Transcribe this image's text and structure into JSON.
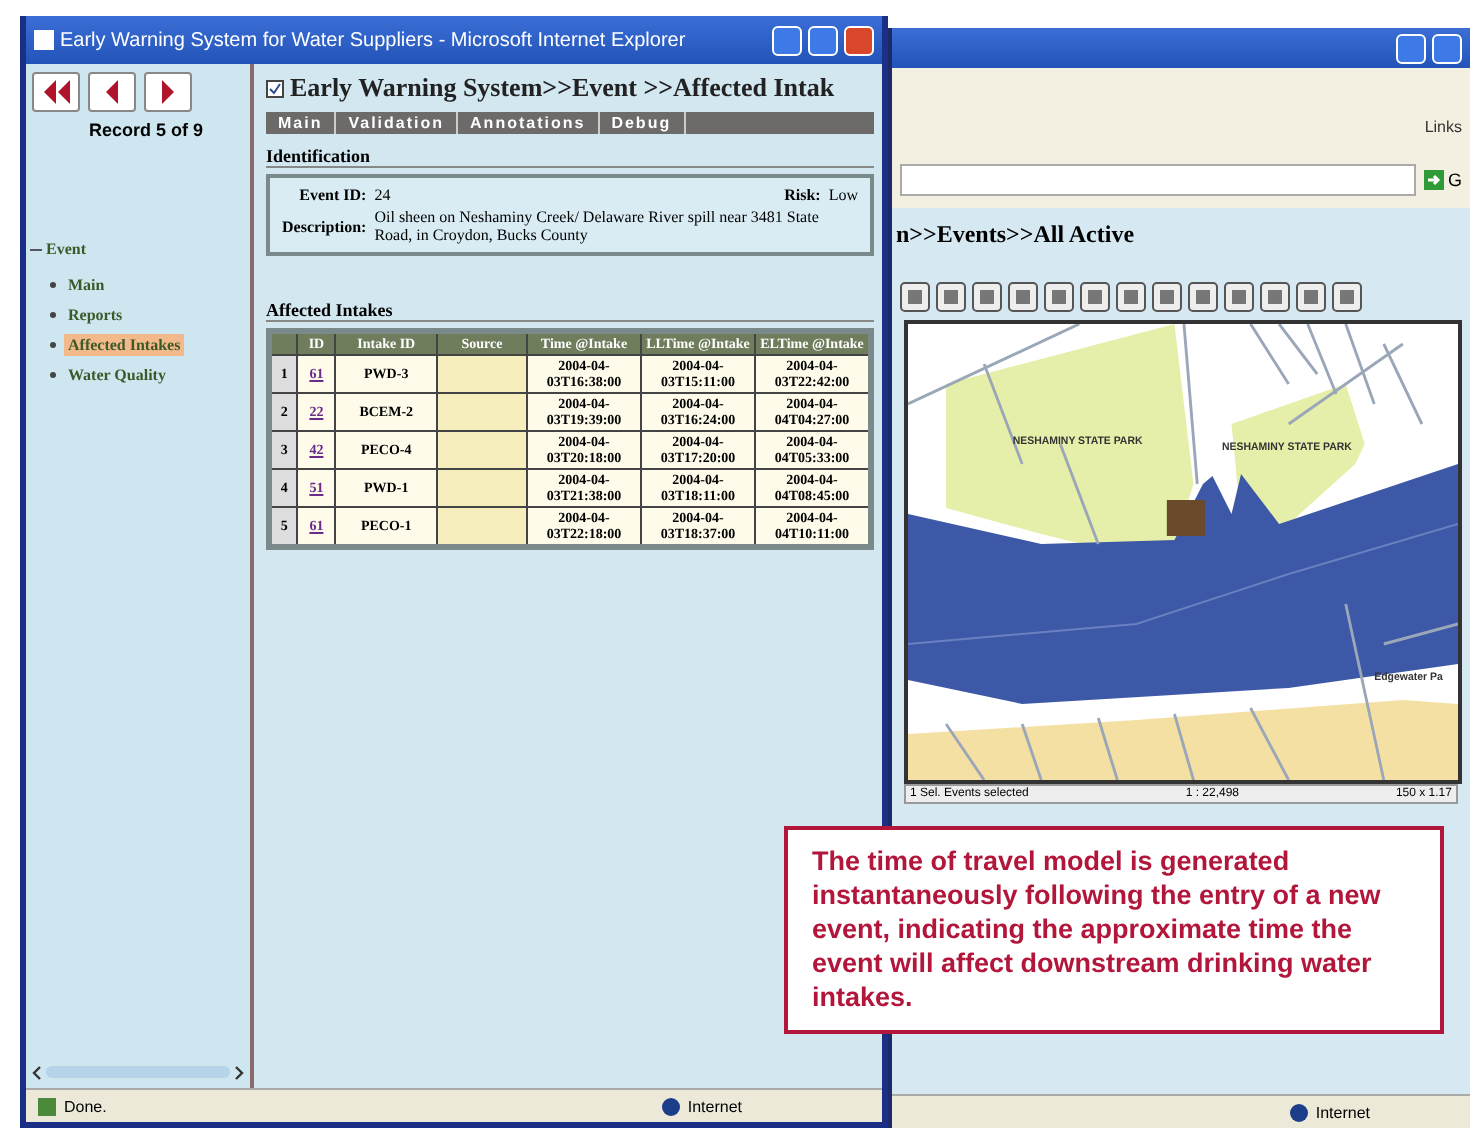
{
  "back_window": {
    "links_label": "Links",
    "go_label": "G",
    "breadcrumb": "n>>Events>>All Active",
    "map_labels": [
      {
        "text": "NESHAMINY STATE PARK"
      },
      {
        "text": "NESHAMINY STATE PARK"
      },
      {
        "text": "Edgewater Pa"
      }
    ],
    "map_status": [
      "1 Sel. Events selected",
      "1 : 22,498",
      "150 x 1.17"
    ],
    "status": "Internet"
  },
  "front_window": {
    "title": "Early Warning System for Water Suppliers - Microsoft Internet Explorer",
    "record": "Record 5 of 9",
    "tree": [
      {
        "label": "Event",
        "expanded": true,
        "children": [
          {
            "label": "Main",
            "selected": false
          },
          {
            "label": "Reports",
            "selected": false
          },
          {
            "label": "Affected Intakes",
            "selected": true
          },
          {
            "label": "Water Quality",
            "selected": false
          }
        ]
      }
    ],
    "breadcrumb": "Early Warning System>>Event >>Affected Intak",
    "tabs": [
      "Main",
      "Validation",
      "Annotations",
      "Debug"
    ],
    "identification": {
      "heading": "Identification",
      "event_id_label": "Event ID:",
      "event_id": "24",
      "risk_label": "Risk:",
      "risk": "Low",
      "description_label": "Description:",
      "description": "Oil sheen on Neshaminy Creek/ Delaware River spill near 3481 State Road, in Croydon, Bucks County"
    },
    "intakes": {
      "heading": "Affected Intakes",
      "columns": [
        "ID",
        "Intake ID",
        "Source",
        "Time @Intake",
        "LLTime @Intake",
        "ELTime @Intake"
      ],
      "rows": [
        {
          "n": "1",
          "id": "61",
          "intake": "PWD-3",
          "source": "",
          "time": "2004-04-03T16:38:00",
          "lltime": "2004-04-03T15:11:00",
          "eltime": "2004-04-03T22:42:00"
        },
        {
          "n": "2",
          "id": "22",
          "intake": "BCEM-2",
          "source": "",
          "time": "2004-04-03T19:39:00",
          "lltime": "2004-04-03T16:24:00",
          "eltime": "2004-04-04T04:27:00"
        },
        {
          "n": "3",
          "id": "42",
          "intake": "PECO-4",
          "source": "",
          "time": "2004-04-03T20:18:00",
          "lltime": "2004-04-03T17:20:00",
          "eltime": "2004-04-04T05:33:00"
        },
        {
          "n": "4",
          "id": "51",
          "intake": "PWD-1",
          "source": "",
          "time": "2004-04-03T21:38:00",
          "lltime": "2004-04-03T18:11:00",
          "eltime": "2004-04-04T08:45:00"
        },
        {
          "n": "5",
          "id": "61",
          "intake": "PECO-1",
          "source": "",
          "time": "2004-04-03T22:18:00",
          "lltime": "2004-04-03T18:37:00",
          "eltime": "2004-04-04T10:11:00"
        }
      ]
    },
    "status": "Done.",
    "status_zone": "Internet"
  },
  "callout": "The time of travel model is generated instantaneously following the entry of a new event, indicating the approximate time the event will affect downstream drinking water intakes."
}
